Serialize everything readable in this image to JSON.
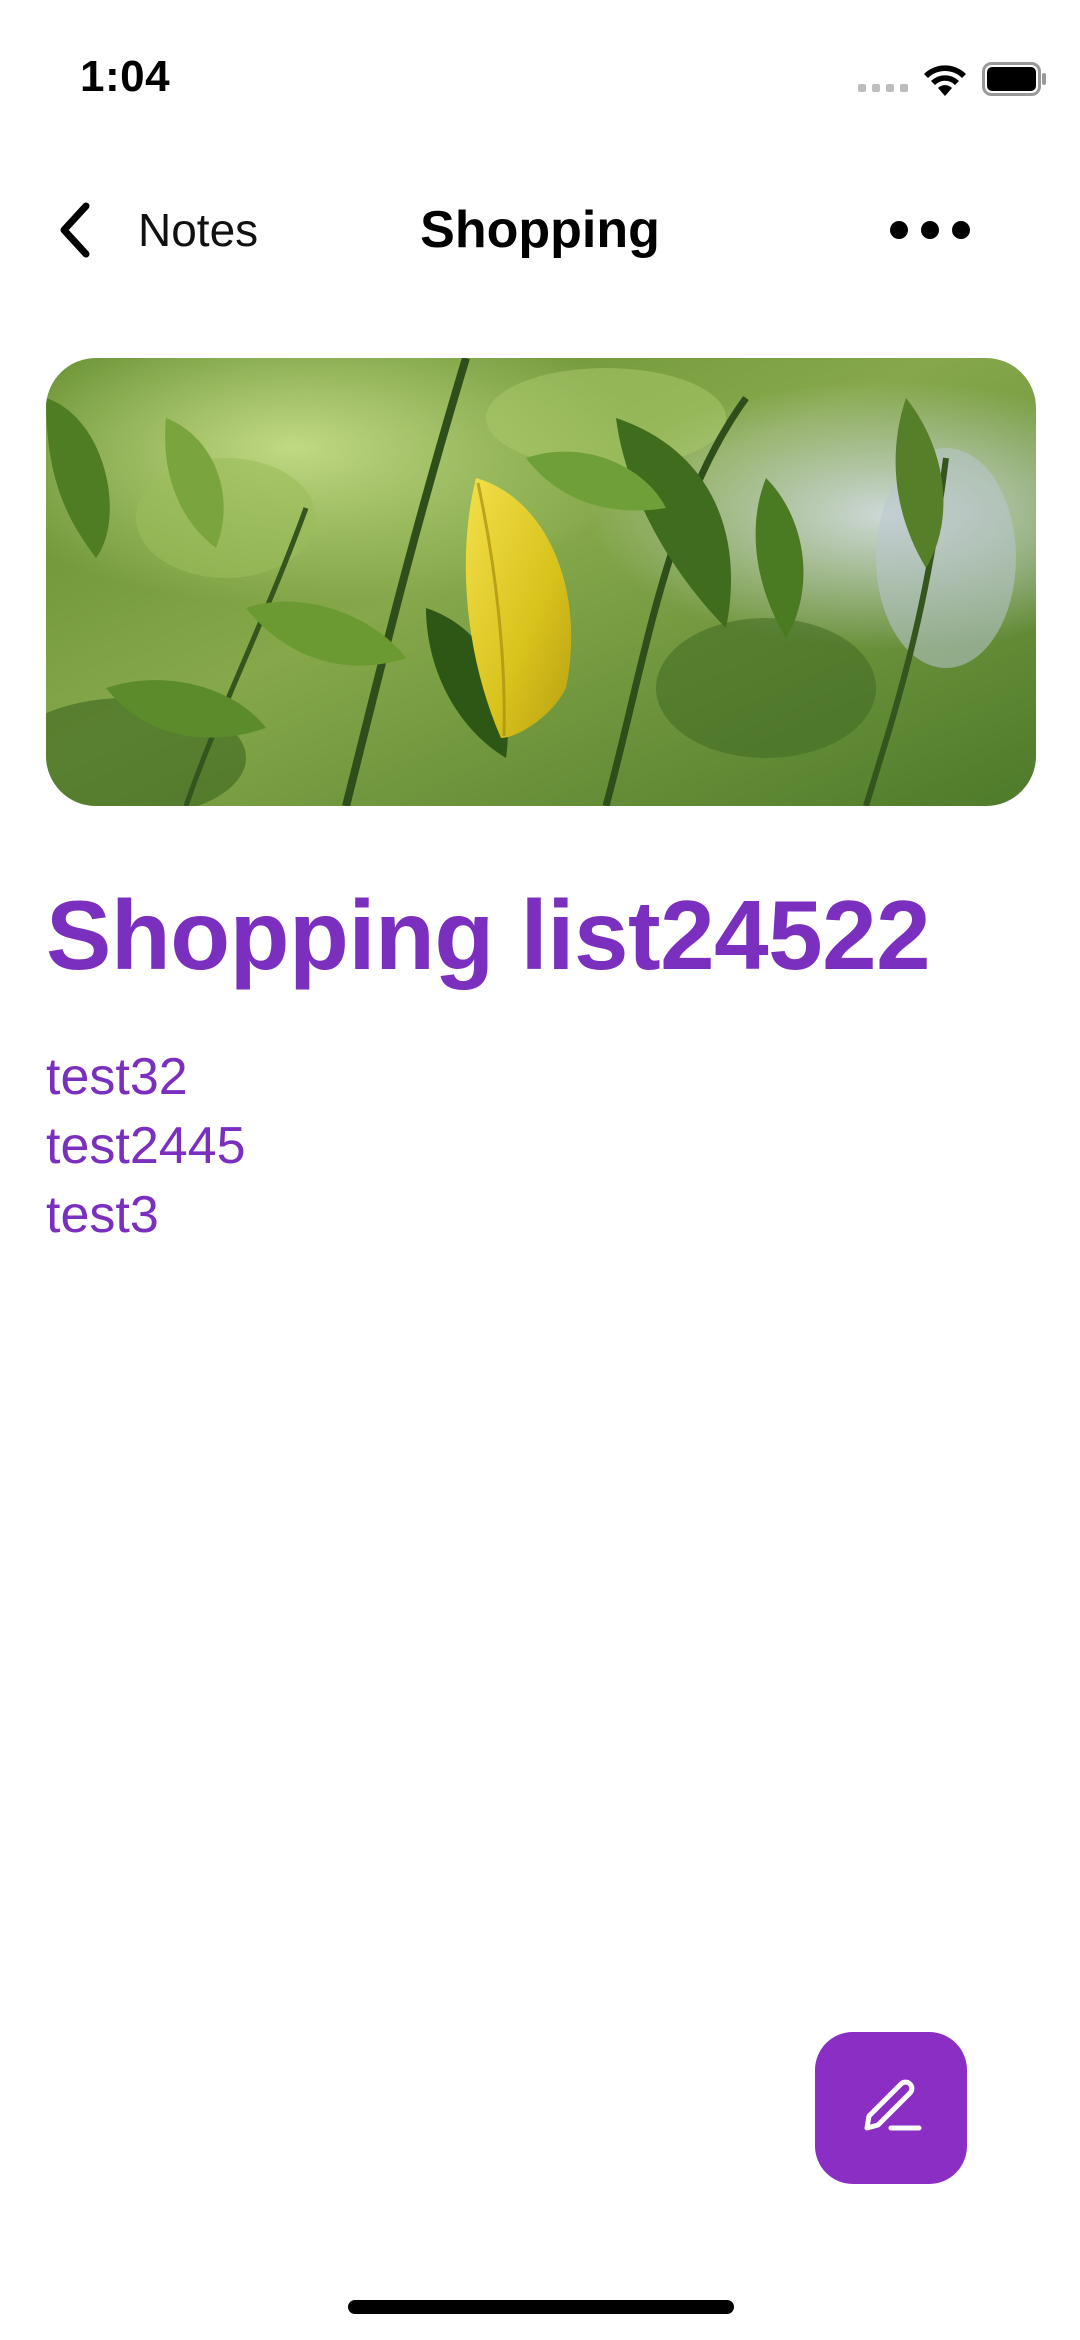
{
  "status_bar": {
    "time": "1:04"
  },
  "nav": {
    "back_label": "Notes",
    "title": "Shopping"
  },
  "note": {
    "title": "Shopping list24522",
    "lines": [
      "test32",
      "test2445",
      "test3"
    ]
  },
  "colors": {
    "accent": "#7b2fbe",
    "fab": "#8a2ec4"
  },
  "icons": {
    "back": "chevron-left-icon",
    "more": "ellipsis-icon",
    "edit": "pencil-icon",
    "wifi": "wifi-icon",
    "battery": "battery-icon",
    "signal": "cellular-signal-icon"
  }
}
